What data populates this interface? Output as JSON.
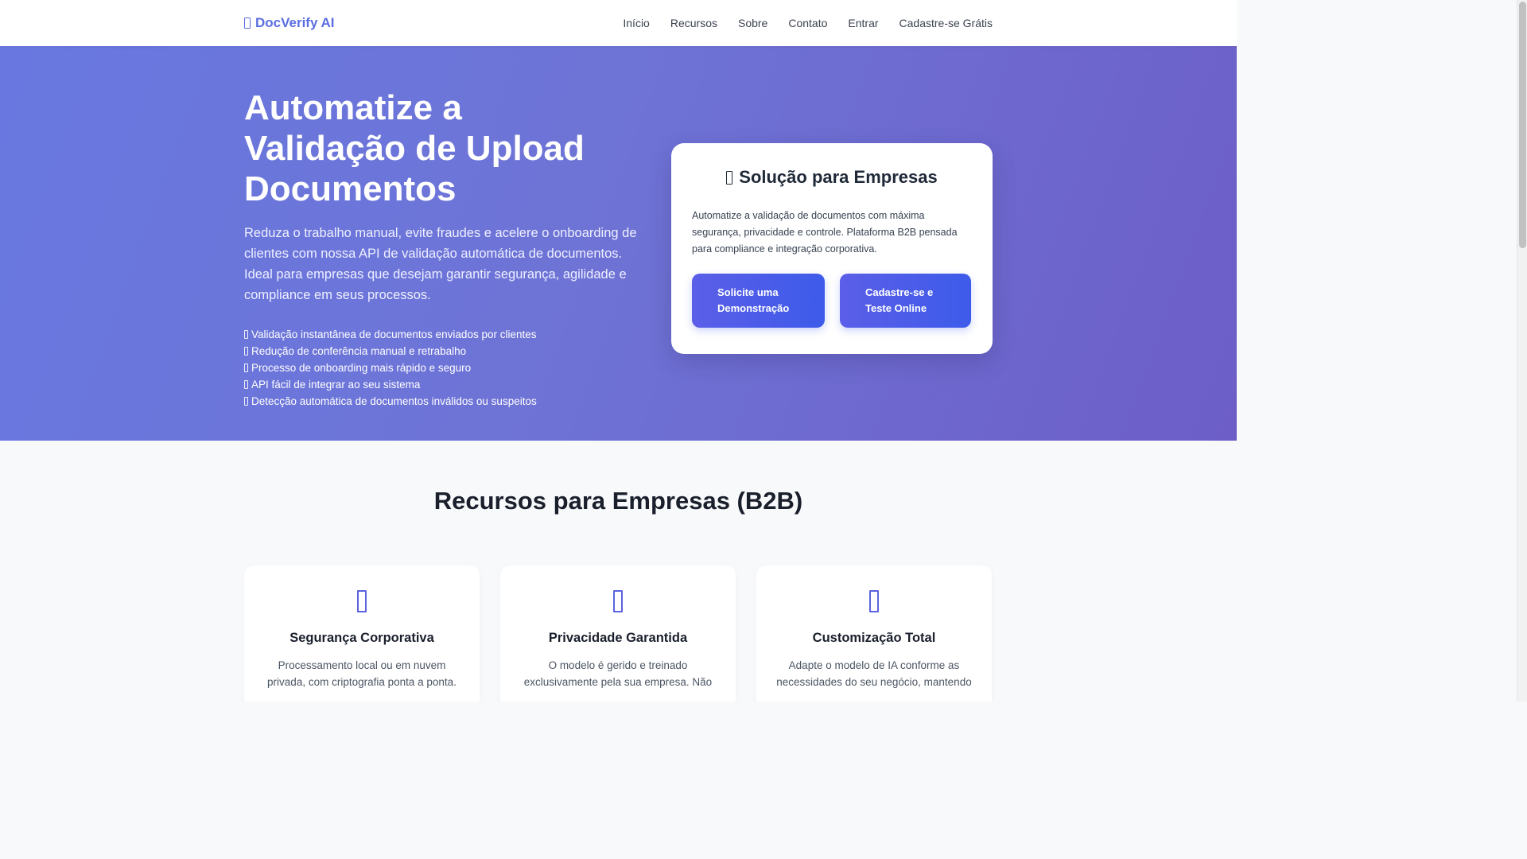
{
  "navbar": {
    "brand": "DocVerify AI",
    "links": [
      "Início",
      "Recursos",
      "Sobre",
      "Contato",
      "Entrar",
      "Cadastre-se Grátis"
    ]
  },
  "hero": {
    "title": "Automatize a Validação de Upload Documentos",
    "description": "Reduza o trabalho manual, evite fraudes e acelere o onboarding de clientes com nossa API de validação automática de documentos. Ideal para empresas que desejam garantir segurança, agilidade e compliance em seus processos.",
    "features": [
      "Validação instantânea de documentos enviados por clientes",
      "Redução de conferência manual e retrabalho",
      "Processo de onboarding mais rápido e seguro",
      "API fácil de integrar ao seu sistema",
      "Detecção automática de documentos inválidos ou suspeitos"
    ]
  },
  "solution_card": {
    "title": "Solução para Empresas",
    "text": "Automatize a validação de documentos com máxima segurança, privacidade e controle. Plataforma B2B pensada para compliance e integração corporativa.",
    "demo_button": "Solicite uma Demonstração",
    "signup_button": "Cadastre-se e Teste Online"
  },
  "resources": {
    "title": "Recursos para Empresas (B2B)",
    "cards": [
      {
        "icon": "shield-icon",
        "title": "Segurança Corporativa",
        "description": "Processamento local ou em nuvem privada, com criptografia ponta a ponta."
      },
      {
        "icon": "lock-icon",
        "title": "Privacidade Garantida",
        "description": "O modelo é gerido e treinado exclusivamente pela sua empresa. Não"
      },
      {
        "icon": "settings-icon",
        "title": "Customização Total",
        "description": "Adapte o modelo de IA conforme as necessidades do seu negócio, mantendo"
      }
    ]
  },
  "colors": {
    "brand": "#5b6ee1",
    "hero_gradient_start": "#6878e0",
    "hero_gradient_end": "#6d5ec7",
    "button": "#4a5ce9"
  }
}
